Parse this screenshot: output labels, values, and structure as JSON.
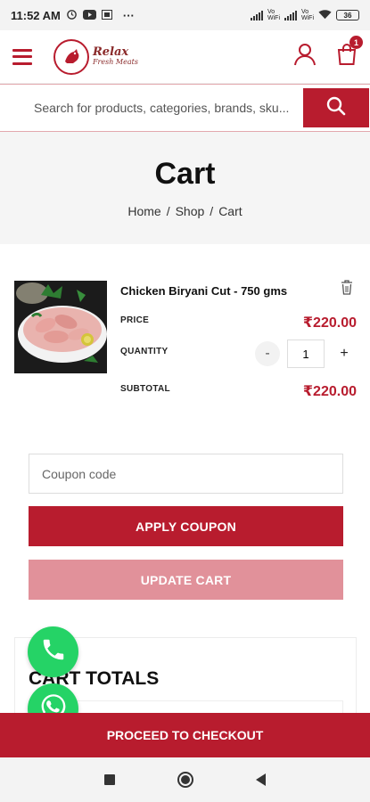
{
  "status_bar": {
    "time": "11:52 AM",
    "more": "···",
    "net1": "Vo\nWiFi",
    "battery": "36"
  },
  "header": {
    "logo_text": "Relax",
    "logo_subtext": "Fresh Meats",
    "cart_count": "1",
    "brand_color": "#b81c2e"
  },
  "search": {
    "placeholder": "Search for products, categories, brands, sku..."
  },
  "page": {
    "title": "Cart",
    "breadcrumb": [
      "Home",
      "Shop",
      "Cart"
    ],
    "breadcrumb_sep": "/"
  },
  "cart_item": {
    "name": "Chicken Biryani Cut - 750 gms",
    "price_label": "PRICE",
    "price": "₹220.00",
    "quantity_label": "QUANTITY",
    "quantity": "1",
    "minus": "-",
    "plus": "+",
    "subtotal_label": "SUBTOTAL",
    "subtotal": "₹220.00"
  },
  "coupon": {
    "placeholder": "Coupon code",
    "apply_label": "APPLY COUPON",
    "update_label": "UPDATE CART"
  },
  "totals": {
    "title": "CART TOTALS"
  },
  "checkout": {
    "label": "PROCEED TO CHECKOUT"
  },
  "icons": {
    "menu": "hamburger-menu-icon",
    "account": "user-icon",
    "cart": "shopping-bag-icon",
    "search": "search-icon",
    "delete": "trash-icon",
    "phone": "phone-icon",
    "whatsapp": "whatsapp-icon"
  }
}
